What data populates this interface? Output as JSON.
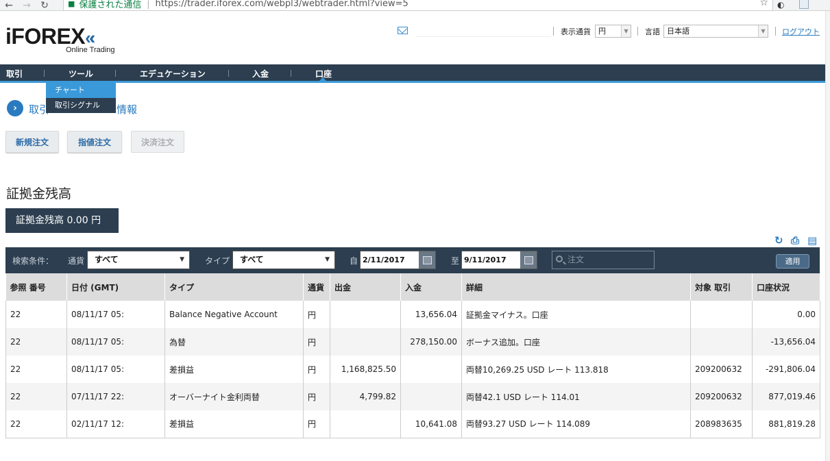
{
  "browser": {
    "secure_label": "保護された通信",
    "url": "https://trader.iforex.com/webpl3/webtrader.html?view=5"
  },
  "header": {
    "logo_text": "iFOREX",
    "logo_sub": "Online Trading",
    "currency_label": "表示通貨",
    "currency_value": "円",
    "language_label": "言語",
    "language_value": "日本語",
    "logout": "ログアウト"
  },
  "menu": {
    "items": [
      {
        "label": "取引"
      },
      {
        "label": "ツール"
      },
      {
        "label": "エデュケーション"
      },
      {
        "label": "入金"
      },
      {
        "label": "口座"
      }
    ],
    "dropdown": [
      {
        "label": "チャート"
      },
      {
        "label": "取引シグナル"
      }
    ]
  },
  "breadcrumb": {
    "left": "取引",
    "right": "情報"
  },
  "actions": {
    "new_order": "新規注文",
    "limit_order": "指値注文",
    "close_order": "決済注文"
  },
  "balance": {
    "title": "証拠金残高",
    "box_text": "証拠金残高 0.00 円"
  },
  "filter": {
    "criteria_label": "検索条件：",
    "currency_label": "通貨",
    "currency_value": "すべて",
    "type_label": "タイプ",
    "type_value": "すべて",
    "from_label": "自",
    "from_date": "2/11/2017",
    "to_label": "至",
    "to_date": "9/11/2017",
    "search_placeholder": "注文",
    "apply": "適用"
  },
  "table": {
    "headers": [
      "参照 番号",
      "日付 (GMT)",
      "タイプ",
      "通貨",
      "出金",
      "入金",
      "詳細",
      "対象 取引",
      "口座状況"
    ],
    "rows": [
      {
        "ref": "22",
        "date": "08/11/17 05:",
        "type": "Balance Negative Account",
        "cur": "円",
        "out": "",
        "in": "13,656.04",
        "detail": "証拠金マイナス。口座",
        "target": "",
        "status": "0.00"
      },
      {
        "ref": "22",
        "date": "08/11/17 05:",
        "type": "為替",
        "cur": "円",
        "out": "",
        "in": "278,150.00",
        "detail": "ボーナス追加。口座",
        "target": "",
        "status": "-13,656.04"
      },
      {
        "ref": "22",
        "date": "08/11/17 05:",
        "type": "差損益",
        "cur": "円",
        "out": "1,168,825.50",
        "in": "",
        "detail": "両替10,269.25 USD レート 113.818",
        "target": "209200632",
        "status": "-291,806.04"
      },
      {
        "ref": "22",
        "date": "07/11/17 22:",
        "type": "オーバーナイト金利両替",
        "cur": "円",
        "out": "4,799.82",
        "in": "",
        "detail": "両替42.1 USD レート 114.01",
        "target": "209200632",
        "status": "877,019.46"
      },
      {
        "ref": "22",
        "date": "02/11/17 12:",
        "type": "差損益",
        "cur": "円",
        "out": "",
        "in": "10,641.08",
        "detail": "両替93.27 USD レート 114.089",
        "target": "208983635",
        "status": "881,819.28"
      }
    ]
  },
  "colors": {
    "navy": "#2c3e50",
    "accent_blue": "#3a9ad9",
    "link_blue": "#2a7ac0",
    "positive_green": "#5aa84a"
  }
}
